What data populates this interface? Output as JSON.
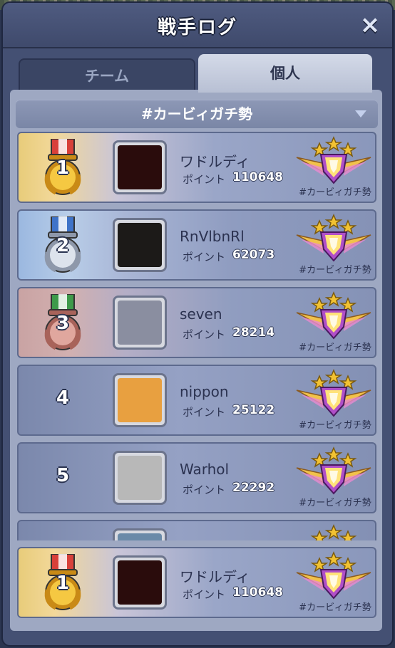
{
  "window": {
    "title": "戦手ログ",
    "close_icon": "×"
  },
  "tabs": [
    {
      "label": "チーム",
      "active": false
    },
    {
      "label": "個人",
      "active": true
    }
  ],
  "filter": {
    "selected": "#カービィガチ勢"
  },
  "rows": [
    {
      "rank": "1",
      "name": "ワドルディ",
      "points_label": "ポイント",
      "points": "110648",
      "team": "#カービィガチ勢",
      "medal": "gold-medal-icon",
      "avatar_color": "#2a0c0c"
    },
    {
      "rank": "2",
      "name": "RnVlbnRl",
      "points_label": "ポイント",
      "points": "62073",
      "team": "#カービィガチ勢",
      "medal": "silver-medal-icon",
      "avatar_color": "#1c1a18"
    },
    {
      "rank": "3",
      "name": "seven",
      "points_label": "ポイント",
      "points": "28214",
      "team": "#カービィガチ勢",
      "medal": "bronze-medal-icon",
      "avatar_color": "#8a8ea0"
    },
    {
      "rank": "4",
      "name": "nippon",
      "points_label": "ポイント",
      "points": "25122",
      "team": "#カービィガチ勢",
      "medal": "",
      "avatar_color": "#e8a040"
    },
    {
      "rank": "5",
      "name": "Warhol",
      "points_label": "ポイント",
      "points": "22292",
      "team": "#カービィガチ勢",
      "medal": "",
      "avatar_color": "#b8b8b8"
    },
    {
      "rank": "",
      "name": "",
      "points_label": "",
      "points": "",
      "team": "",
      "medal": "",
      "avatar_color": "#6a8aa8"
    }
  ],
  "self": {
    "rank": "1",
    "name": "ワドルディ",
    "points_label": "ポイント",
    "points": "110648",
    "team": "#カービィガチ勢",
    "medal": "gold-medal-icon",
    "avatar_color": "#2a0c0c"
  },
  "colors": {
    "gold": "#f2c232",
    "silver": "#c8d0dc",
    "bronze": "#d9968c"
  }
}
